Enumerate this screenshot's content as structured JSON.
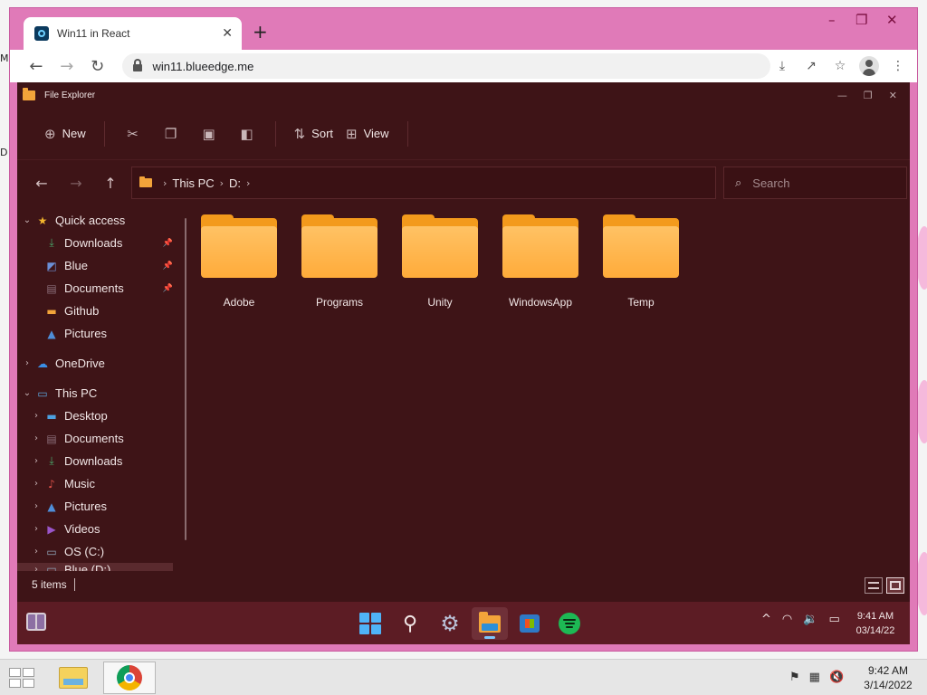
{
  "browser": {
    "tab_title": "Win11 in React",
    "tab_close": "✕",
    "new_tab": "+",
    "window_controls": [
      "–",
      "❐",
      "✕"
    ],
    "nav": {
      "back": "←",
      "forward": "→",
      "reload": "↻"
    },
    "url": "win11.blueedge.me",
    "toolbar_icons": [
      "install-icon",
      "share-icon",
      "star-icon",
      "profile-icon",
      "more-icon"
    ]
  },
  "explorer": {
    "title": "File Explorer",
    "ribbon": {
      "new_label": "New",
      "sort_label": "Sort",
      "view_label": "View"
    },
    "breadcrumb": [
      "This PC",
      "D:"
    ],
    "search_placeholder": "Search",
    "sidebar": [
      {
        "label": "Quick access",
        "level": 0,
        "chevron": "open",
        "icon": "star-icon",
        "color": "#f3b52d"
      },
      {
        "label": "Downloads",
        "level": 1,
        "pinned": true,
        "icon": "download-icon",
        "color": "#4aa86b"
      },
      {
        "label": "Blue",
        "level": 1,
        "pinned": true,
        "icon": "user-folder-icon",
        "color": "#6b8fd6"
      },
      {
        "label": "Documents",
        "level": 1,
        "pinned": true,
        "icon": "documents-icon",
        "color": "#8b6e7a"
      },
      {
        "label": "Github",
        "level": 1,
        "icon": "folder-icon",
        "color": "#f3a43a"
      },
      {
        "label": "Pictures",
        "level": 1,
        "icon": "pictures-icon",
        "color": "#4f8ed8"
      },
      {
        "label": "OneDrive",
        "level": 0,
        "chevron": "closed",
        "icon": "cloud-icon",
        "color": "#3a8ee6"
      },
      {
        "label": "This PC",
        "level": 0,
        "chevron": "open",
        "icon": "monitor-icon",
        "color": "#5ba3d9"
      },
      {
        "label": "Desktop",
        "level": 1,
        "chevron": "closed",
        "icon": "desktop-icon",
        "color": "#4da0e0"
      },
      {
        "label": "Documents",
        "level": 1,
        "chevron": "closed",
        "icon": "documents-icon",
        "color": "#8b6e7a"
      },
      {
        "label": "Downloads",
        "level": 1,
        "chevron": "closed",
        "icon": "download-icon",
        "color": "#4aa86b"
      },
      {
        "label": "Music",
        "level": 1,
        "chevron": "closed",
        "icon": "music-icon",
        "color": "#e2534a"
      },
      {
        "label": "Pictures",
        "level": 1,
        "chevron": "closed",
        "icon": "pictures-icon",
        "color": "#4f8ed8"
      },
      {
        "label": "Videos",
        "level": 1,
        "chevron": "closed",
        "icon": "videos-icon",
        "color": "#9a55c9"
      },
      {
        "label": "OS (C:)",
        "level": 1,
        "chevron": "closed",
        "icon": "drive-icon",
        "color": "#8fa4b8"
      },
      {
        "label": "Blue (D:)",
        "level": 1,
        "chevron": "closed",
        "icon": "drive-icon",
        "color": "#8fa4b8",
        "selected": true
      }
    ],
    "folders": [
      "Adobe",
      "Programs",
      "Unity",
      "WindowsApp",
      "Temp"
    ],
    "status": "5 items"
  },
  "win11_taskbar": {
    "apps": [
      "start-icon",
      "search-icon",
      "settings-icon",
      "file-explorer-icon",
      "store-icon",
      "spotify-icon"
    ],
    "active_app": "file-explorer-icon",
    "tray": [
      "^",
      "wifi-icon",
      "volume-icon",
      "battery-icon"
    ],
    "time": "9:41 AM",
    "date": "03/14/22"
  },
  "host_taskbar": {
    "time": "9:42 AM",
    "date": "3/14/2022"
  },
  "colors": {
    "explorer_bg": "#3e1417",
    "taskbar_bg": "#5c1c24",
    "browser_frame": "#e07ab8",
    "folder_orange": "#ffab3a"
  }
}
